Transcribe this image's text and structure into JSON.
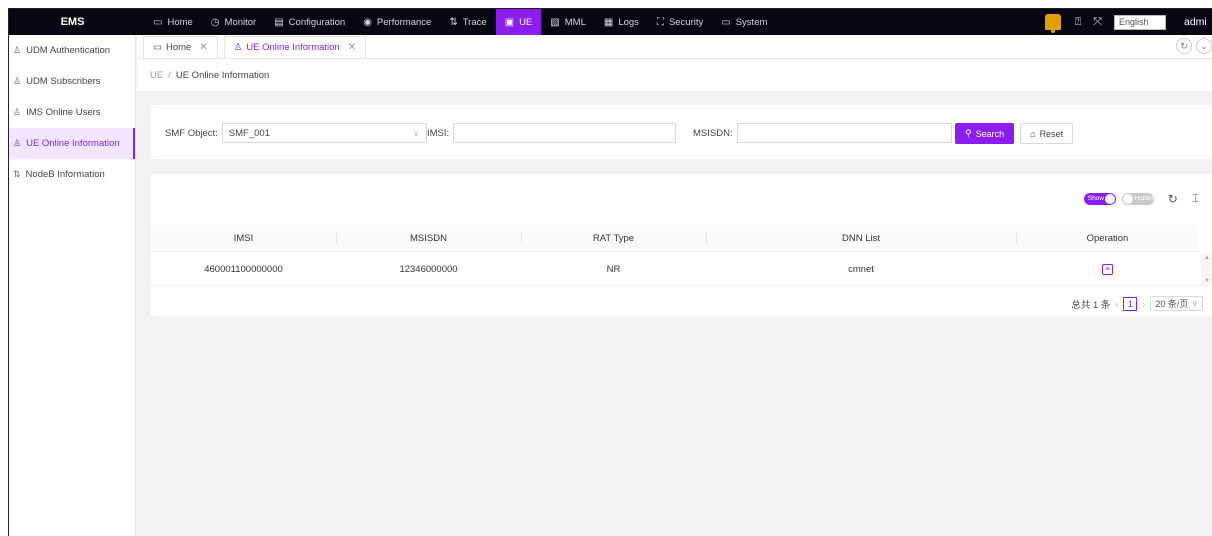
{
  "app": {
    "title": "EMS"
  },
  "nav": [
    {
      "label": "Home",
      "icon": "desktop-icon",
      "glyph": "▭",
      "active": false
    },
    {
      "label": "Monitor",
      "icon": "clock-icon",
      "glyph": "◷",
      "active": false
    },
    {
      "label": "Configuration",
      "icon": "config-icon",
      "glyph": "▤",
      "active": false
    },
    {
      "label": "Performance",
      "icon": "eye-icon",
      "glyph": "◉",
      "active": false
    },
    {
      "label": "Trace",
      "icon": "trace-icon",
      "glyph": "⇅",
      "active": false
    },
    {
      "label": "UE",
      "icon": "ue-icon",
      "glyph": "▣",
      "active": true
    },
    {
      "label": "MML",
      "icon": "edit-icon",
      "glyph": "▧",
      "active": false
    },
    {
      "label": "Logs",
      "icon": "logs-icon",
      "glyph": "▦",
      "active": false
    },
    {
      "label": "Security",
      "icon": "security-icon",
      "glyph": "⛶",
      "active": false
    },
    {
      "label": "System",
      "icon": "folder-icon",
      "glyph": "▭",
      "active": false
    }
  ],
  "topright": {
    "language": "English",
    "user": "admi"
  },
  "sidebar": {
    "items": [
      {
        "label": "UDM Authentication",
        "active": false
      },
      {
        "label": "UDM Subscribers",
        "active": false
      },
      {
        "label": "IMS Online Users",
        "active": false
      },
      {
        "label": "UE Online Information",
        "active": true
      },
      {
        "label": "NodeB Information",
        "active": false
      }
    ]
  },
  "tabs": [
    {
      "label": "Home",
      "active": false
    },
    {
      "label": "UE Online Information",
      "active": true
    }
  ],
  "breadcrumb": {
    "root": "UE",
    "sep": "/",
    "current": "UE Online Information"
  },
  "search": {
    "smf_label": "SMF Object:",
    "smf_value": "SMF_001",
    "imsi_label": "IMSI:",
    "imsi_value": "",
    "msisdn_label": "MSISDN:",
    "msisdn_value": "",
    "search_button": "Search",
    "reset_button": "Reset"
  },
  "table": {
    "show_label": "Show",
    "hidden_label": "Hidden",
    "columns": [
      "IMSI",
      "MSISDN",
      "RAT Type",
      "DNN List",
      "Operation"
    ],
    "rows": [
      {
        "imsi": "460001100000000",
        "msisdn": "12346000000",
        "rat_type": "NR",
        "dnn_list": "cmnet"
      }
    ]
  },
  "pagination": {
    "total": "总共 1 条",
    "current_page": "1",
    "page_size": "20 条/页"
  },
  "colors": {
    "accent": "#8b1df0",
    "topbar": "#070714"
  }
}
